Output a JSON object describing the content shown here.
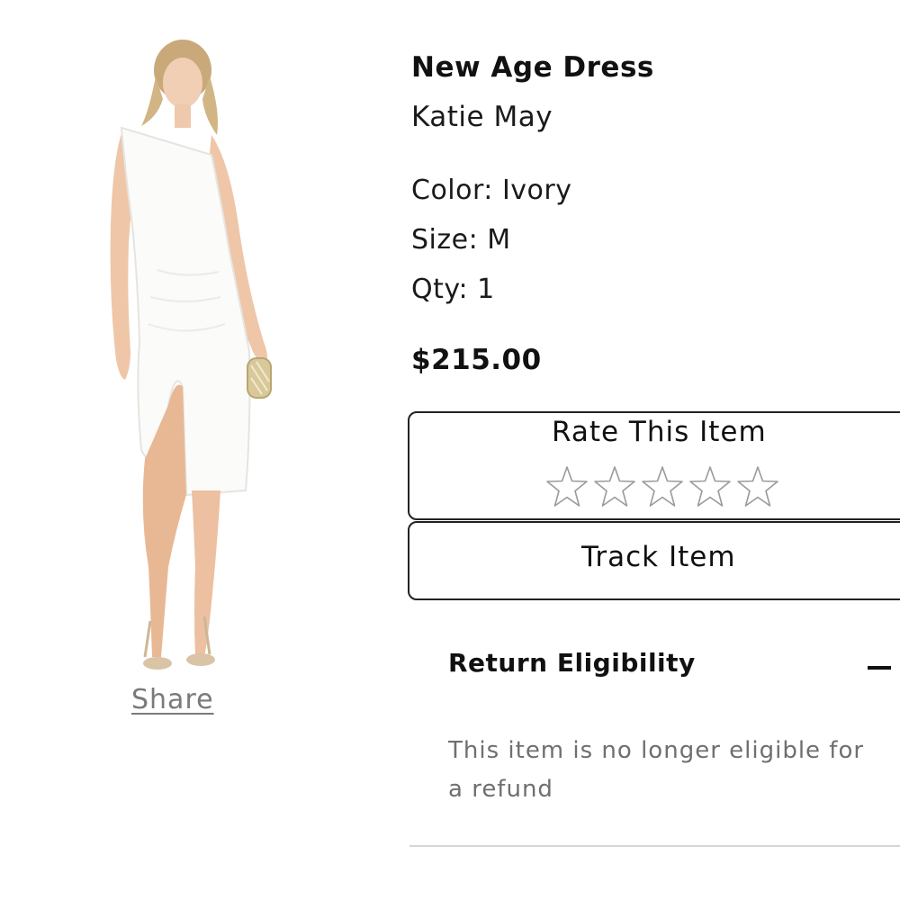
{
  "product": {
    "name": "New Age Dress",
    "brand": "Katie May",
    "color": "Color: Ivory",
    "size": "Size: M",
    "qty": "Qty: 1",
    "price": "$215.00",
    "image_icon": "product-photo-one-shoulder-white-dress"
  },
  "share": {
    "label": "Share"
  },
  "rating": {
    "title": "Rate This Item",
    "max_stars": 5,
    "current": 0,
    "star_icon": "star-outline-icon"
  },
  "track": {
    "label": "Track Item"
  },
  "returns": {
    "title": "Return Eligibility",
    "toggle_icon": "minus-icon",
    "message": "This item is no longer eligible for a refund"
  },
  "colors": {
    "text": "#111111",
    "muted": "#6f6f6f",
    "border": "#222222",
    "divider": "#d6d6d6",
    "star": "#9a9a9a"
  }
}
